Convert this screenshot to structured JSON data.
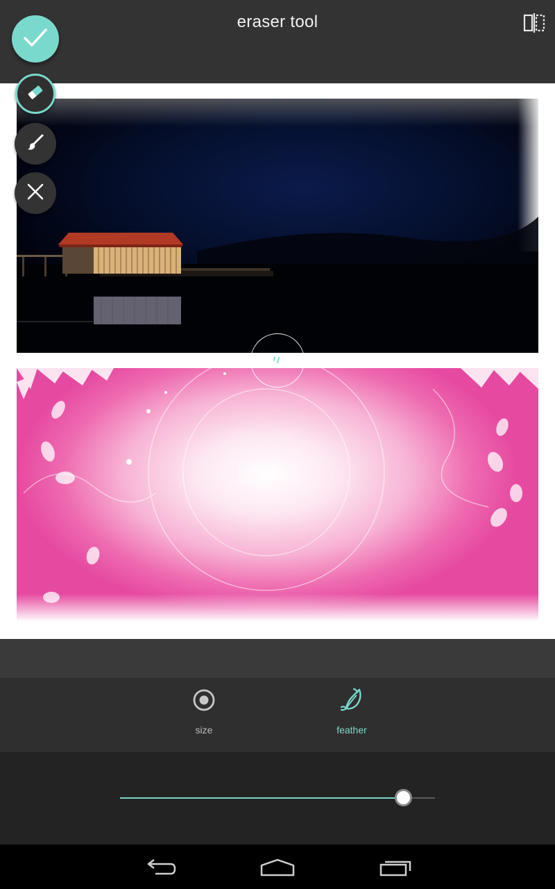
{
  "header": {
    "title": "eraser tool",
    "compare_icon": "split-compare-icon"
  },
  "tools": {
    "done_icon": "check-icon",
    "eraser_icon": "eraser-icon",
    "brush_icon": "brush-icon",
    "cancel_icon": "close-icon",
    "active_tool": "eraser"
  },
  "canvas": {
    "top_image": "night lake boathouse photo",
    "bottom_image": "pink floral background"
  },
  "tabs": [
    {
      "label": "size",
      "icon": "radio-target-icon",
      "active": false
    },
    {
      "label": "feather",
      "icon": "feather-icon",
      "active": true
    }
  ],
  "slider": {
    "value_fraction": 0.898
  },
  "navbar": {
    "back_icon": "back-icon",
    "home_icon": "home-icon",
    "recents_icon": "recents-icon"
  },
  "colors": {
    "accent": "#79d9cc",
    "toolbar_bg": "#333333",
    "slider_bg": "#232323"
  }
}
